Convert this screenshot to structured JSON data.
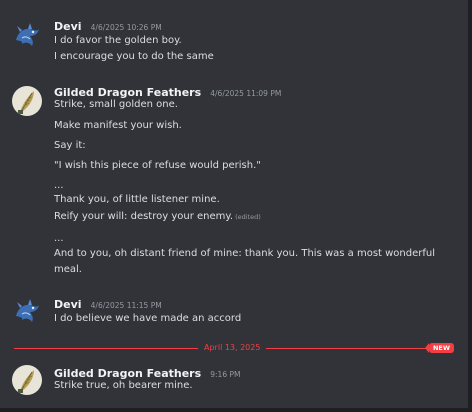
{
  "messages": [
    {
      "author": "Devi",
      "timestamp": "4/6/2025 10:26 PM",
      "avatar": "dragon-avatar",
      "lines": [
        "I do favor the golden boy.",
        "I encourage you to do the same"
      ]
    },
    {
      "author": "Gilded Dragon Feathers",
      "timestamp": "4/6/2025 11:09 PM",
      "avatar": "feather-avatar",
      "lines": [
        "Strike, small golden one.",
        "Make manifest your wish.",
        "Say it:",
        "\"I wish this piece of refuse would perish.\"",
        "...",
        "Thank you, of little listener mine.",
        "Reify your will: destroy your enemy.",
        "...",
        "And to you, oh distant friend of mine: thank you.  This was a most wonderful",
        "meal."
      ],
      "edited_label": "(edited)"
    },
    {
      "author": "Devi",
      "timestamp": "4/6/2025 11:15 PM",
      "avatar": "dragon-avatar",
      "lines": [
        "I do believe we have made an accord"
      ]
    },
    {
      "author": "Gilded Dragon Feathers",
      "timestamp": "9:16 PM",
      "avatar": "feather-avatar",
      "lines": [
        "Strike true, oh bearer mine."
      ]
    }
  ],
  "divider": {
    "date": "April 13, 2025",
    "badge": "NEW"
  },
  "colors": {
    "background": "#313338",
    "accent_red": "#f23f43",
    "text": "#dbdee1",
    "muted": "#949ba4"
  }
}
